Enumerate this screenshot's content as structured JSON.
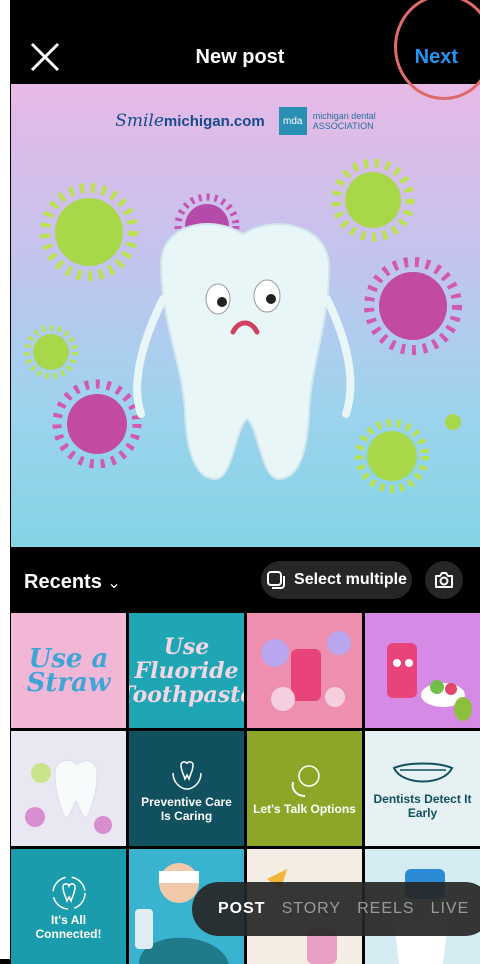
{
  "header": {
    "title": "New post",
    "next_label": "Next"
  },
  "preview": {
    "logo_smile": "Smile",
    "logo_domain": "michigan.com",
    "logo_mda_line1": "michigan dental",
    "logo_mda_line2": "ASSOCIATION",
    "mda_mark": "mda"
  },
  "recents": {
    "label": "Recents",
    "select_multiple": "Select multiple"
  },
  "tiles": [
    {
      "text": "Use a Straw",
      "bg": "#f2b6d6"
    },
    {
      "text": "Use Fluoride Toothpaste",
      "bg": "#1fa6b4"
    },
    {
      "text": "",
      "bg": "#ef8fb0"
    },
    {
      "text": "",
      "bg": "#d58be6"
    },
    {
      "text": "",
      "bg": "#e9e7f2"
    },
    {
      "text": "Preventive Care Is Caring",
      "bg": "#10505f"
    },
    {
      "text": "Let's Talk Options",
      "bg": "#8ea628"
    },
    {
      "text": "Dentists Detect It Early",
      "bg": "#e6f1f3"
    },
    {
      "text": "It's All Connected!",
      "bg": "#1b9cac"
    },
    {
      "text": "",
      "bg": "#39b3cf"
    },
    {
      "text": "",
      "bg": "#f3ede4"
    },
    {
      "text": "",
      "bg": "#d5edf2"
    }
  ],
  "modes": [
    "POST",
    "STORY",
    "REELS",
    "LIVE"
  ],
  "colors": {
    "accent": "#2196f3",
    "circle": "#e06a6a"
  }
}
